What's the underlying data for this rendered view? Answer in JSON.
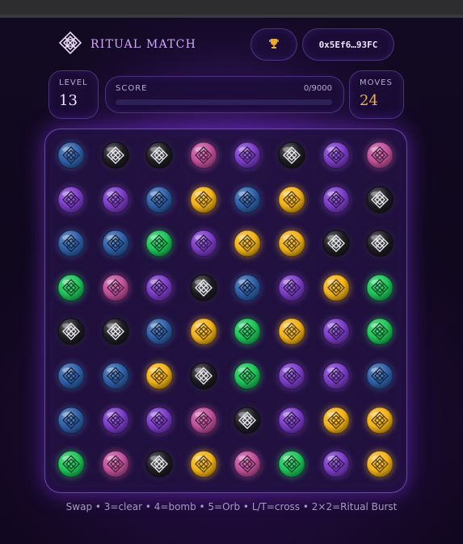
{
  "app": {
    "title": "RITUAL MATCH"
  },
  "header": {
    "logo_icon": "knot-logo-icon",
    "trophy_icon": "trophy-icon",
    "wallet_address": "0x5Ef6…93FC"
  },
  "stats": {
    "level_label": "LEVEL",
    "level_value": "13",
    "score_label": "SCORE",
    "score_text": "0/9000",
    "score_progress": 0,
    "moves_label": "MOVES",
    "moves_value": "24"
  },
  "board": {
    "rows": 8,
    "cols": 8,
    "gem_icon": "ritual-knot-icon",
    "colors": {
      "blue": "#2f5fa8",
      "black": "#1c1c22",
      "pink": "#c0509c",
      "purple": "#7b3cc8",
      "yellow": "#f2b21c",
      "green": "#1fc45a"
    },
    "cells": [
      [
        "blue",
        "black",
        "black",
        "pink",
        "purple",
        "black",
        "purple",
        "pink"
      ],
      [
        "purple",
        "purple",
        "blue",
        "yellow",
        "blue",
        "yellow",
        "purple",
        "black"
      ],
      [
        "blue",
        "blue",
        "green",
        "purple",
        "yellow",
        "yellow",
        "black",
        "black"
      ],
      [
        "green",
        "pink",
        "purple",
        "black",
        "blue",
        "purple",
        "yellow",
        "green"
      ],
      [
        "black",
        "black",
        "blue",
        "yellow",
        "green",
        "yellow",
        "purple",
        "green"
      ],
      [
        "blue",
        "blue",
        "yellow",
        "black",
        "green",
        "purple",
        "purple",
        "blue"
      ],
      [
        "blue",
        "purple",
        "purple",
        "pink",
        "black",
        "purple",
        "yellow",
        "yellow"
      ],
      [
        "green",
        "pink",
        "black",
        "yellow",
        "pink",
        "green",
        "purple",
        "yellow"
      ]
    ]
  },
  "footer": {
    "help_text": "Swap • 3=clear • 4=bomb • 5=Orb • L/T=cross • 2×2=Ritual Burst"
  }
}
